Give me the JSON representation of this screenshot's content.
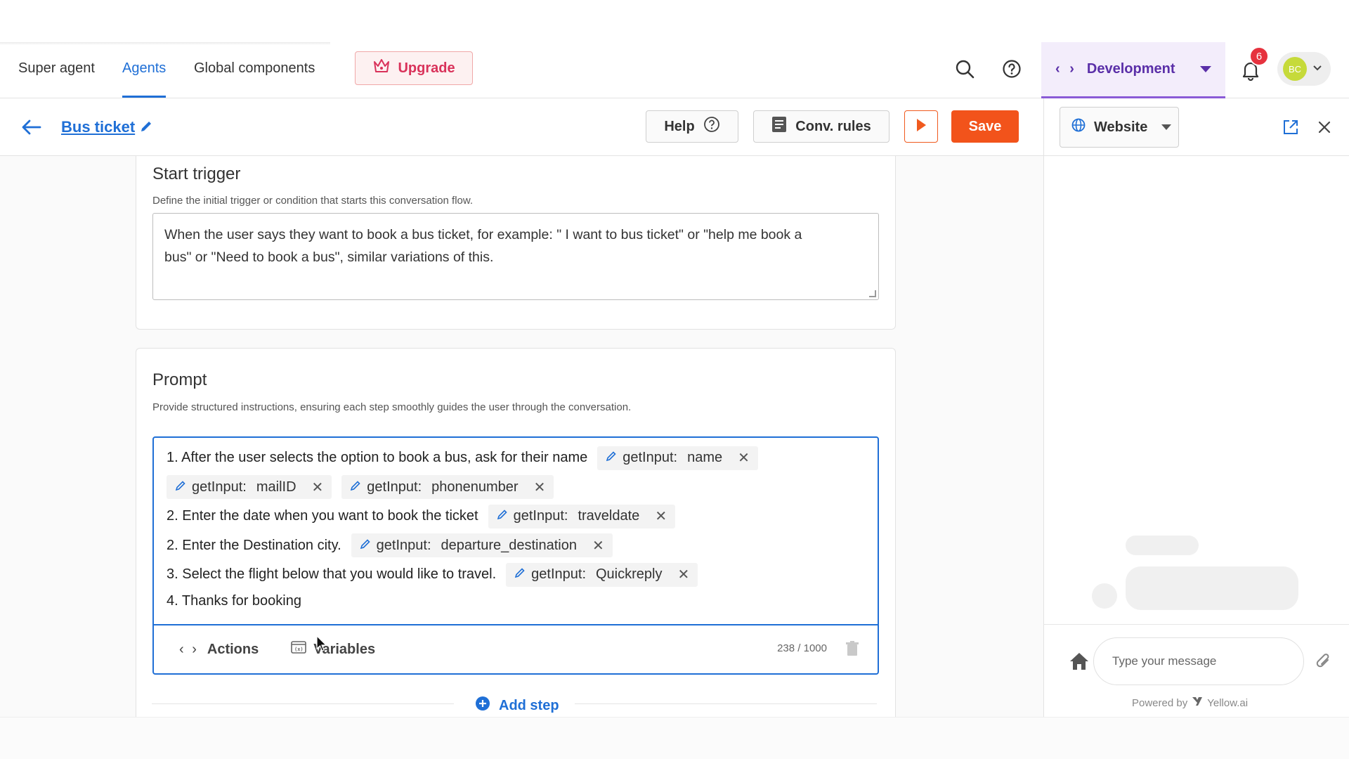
{
  "nav": {
    "tabs": [
      "Super agent",
      "Agents",
      "Global components"
    ],
    "active_tab": "Agents",
    "upgrade_label": "Upgrade",
    "environment": "Development",
    "notification_count": "6",
    "avatar_initials": "BC"
  },
  "subbar": {
    "bot_name": "Bus ticket",
    "help_label": "Help",
    "conv_rules_label": "Conv. rules",
    "save_label": "Save"
  },
  "start_trigger": {
    "title": "Start trigger",
    "description": "Define the initial trigger or condition that starts this conversation flow.",
    "text_line1": "When the user says they want to book a bus ticket, for example:  \" I want to bus ticket\" or \"help me book a",
    "text_line2": "bus\" or \"Need to book a bus\", similar variations of this."
  },
  "prompt": {
    "title": "Prompt",
    "description": "Provide structured instructions, ensuring each step smoothly guides the user through the conversation.",
    "chip_prefix": "getInput:",
    "lines": [
      {
        "text": "1. After the user selects the option to book a bus, ask for their name",
        "chips": [
          "name"
        ]
      },
      {
        "text": "",
        "chips": [
          "mailID",
          "phonenumber"
        ]
      },
      {
        "text": "2. Enter the date when you want to book the ticket",
        "chips": [
          "traveldate"
        ]
      },
      {
        "text": "2. Enter the Destination city.",
        "chips": [
          "departure_destination"
        ]
      },
      {
        "text": "3. Select the flight below that you would like to travel.",
        "chips": [
          "Quickreply"
        ]
      },
      {
        "text": "4. Thanks for booking",
        "chips": []
      }
    ],
    "actions_label": "Actions",
    "variables_label": "Variables",
    "char_count": "238 / 1000",
    "add_step_label": "Add step"
  },
  "preview": {
    "channel": "Website",
    "message_placeholder": "Type your message",
    "powered_by": "Powered by",
    "brand": "Yellow.ai"
  },
  "colors": {
    "accent": "#1f6fd6",
    "save": "#f2531b",
    "env_bg": "#f3edfb",
    "env_text": "#5a2fa8",
    "badge": "#e6323e"
  }
}
